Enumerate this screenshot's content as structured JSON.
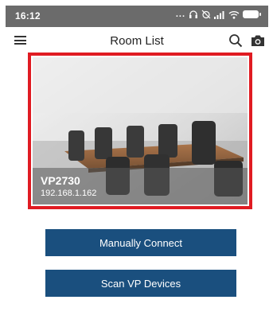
{
  "status_bar": {
    "time": "16:12",
    "dots": "...",
    "bg_color": "#6b6b6b"
  },
  "app_bar": {
    "title": "Room List",
    "menu_icon": "menu-icon",
    "search_icon": "search-icon",
    "camera_icon": "camera-icon"
  },
  "rooms": [
    {
      "name": "VP2730",
      "ip": "192.168.1.162",
      "selected": true,
      "highlight_color": "#e01b22"
    }
  ],
  "actions": {
    "manual_connect": "Manually Connect",
    "scan_devices": "Scan VP Devices",
    "button_color": "#1a4f7e"
  }
}
